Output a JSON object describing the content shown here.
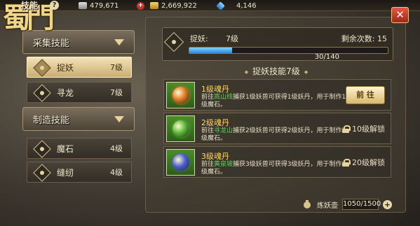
{
  "window": {
    "title": "技能",
    "help_label": "?"
  },
  "logo": {
    "glyphs": "蜀門"
  },
  "resources": {
    "silver": "479,671",
    "gold": "2,669,922",
    "gem": "4,146",
    "add_label": "+"
  },
  "close_label": "✕",
  "sidebar": {
    "categories": [
      {
        "label": "采集技能"
      },
      {
        "label": "制造技能"
      }
    ],
    "items": [
      {
        "label": "捉妖",
        "level": "7级"
      },
      {
        "label": "寻龙",
        "level": "7级"
      },
      {
        "label": "魔石",
        "level": "4级"
      },
      {
        "label": "缝纫",
        "level": "4级"
      }
    ]
  },
  "progress": {
    "skill": "捉妖:",
    "level": "7级",
    "remaining": "剩余次数: 15",
    "current": 30,
    "max": 140,
    "text": "30/140"
  },
  "section_title": "捉妖技能7级",
  "recipes": [
    {
      "name": "1级魂丹",
      "desc_pre": "前往",
      "desc_loc": "嵩山线",
      "desc_post": "捕获1级妖兽可获得1级妖丹，用于制作1级魔石。",
      "action": "前 往",
      "orb_color": "#e07a25"
    },
    {
      "name": "2级魂丹",
      "desc_pre": "前往",
      "desc_loc": "寻龙山",
      "desc_post": "捕获2级妖兽可获得2级妖丹，用于制作2级魔石。",
      "lock": "10级解锁",
      "orb_color": "#58b835"
    },
    {
      "name": "3级魂丹",
      "desc_pre": "前往",
      "desc_loc": "黄泉坡",
      "desc_post": "捕获3级妖兽可获得3级妖丹，用于制作3级魔石。",
      "lock": "20级解锁",
      "orb_color": "#4a5fd0"
    }
  ],
  "footer": {
    "label": "炼妖壶",
    "value": "1050/1500",
    "add_label": "+"
  }
}
